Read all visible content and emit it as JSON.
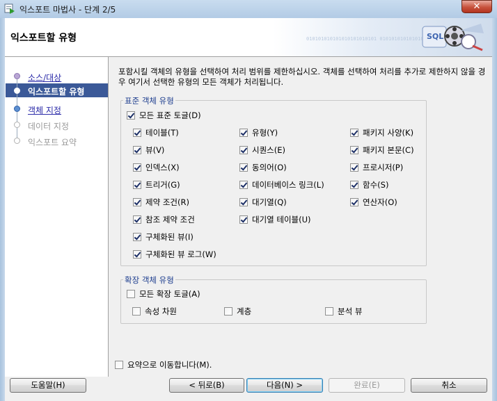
{
  "window": {
    "title": "익스포트 마법사 - 단계 2/5",
    "close_label": "✕"
  },
  "header": {
    "title": "익스포트할 유형",
    "binary_text": "010101010101010101010101 0101010101010101"
  },
  "nav": {
    "steps": [
      {
        "label": "소스/대상",
        "state": "done"
      },
      {
        "label": "익스포트할 유형",
        "state": "current"
      },
      {
        "label": "객체 지정",
        "state": "next"
      },
      {
        "label": "데이터 지정",
        "state": "disabled"
      },
      {
        "label": "익스포트 요약",
        "state": "disabled"
      }
    ]
  },
  "description": "포함시킬 객체의 유형을 선택하여 처리 범위를 제한하십시오. 객체를 선택하여 처리를 추가로 제한하지 않을 경우 여기서 선택한 유형의 모든 객체가 처리됩니다.",
  "standard_group": {
    "legend": "표준 객체 유형",
    "toggle_all": {
      "label": "모든 표준 토글(D)",
      "checked": true
    },
    "items": [
      {
        "label": "테이블(T)",
        "checked": true
      },
      {
        "label": "유형(Y)",
        "checked": true
      },
      {
        "label": "패키지 사양(K)",
        "checked": true
      },
      {
        "label": "뷰(V)",
        "checked": true
      },
      {
        "label": "시퀀스(E)",
        "checked": true
      },
      {
        "label": "패키지 본문(C)",
        "checked": true
      },
      {
        "label": "인덱스(X)",
        "checked": true
      },
      {
        "label": "동의어(O)",
        "checked": true
      },
      {
        "label": "프로시저(P)",
        "checked": true
      },
      {
        "label": "트리거(G)",
        "checked": true
      },
      {
        "label": "데이터베이스 링크(L)",
        "checked": true
      },
      {
        "label": "함수(S)",
        "checked": true
      },
      {
        "label": "제약 조건(R)",
        "checked": true
      },
      {
        "label": "대기열(Q)",
        "checked": true
      },
      {
        "label": "연산자(O)",
        "checked": true
      },
      {
        "label": "참조 제약 조건",
        "checked": true
      },
      {
        "label": "대기열 테이블(U)",
        "checked": true
      },
      {
        "label": "구체화된 뷰(I)",
        "checked": true
      },
      {
        "label": "구체화된 뷰 로그(W)",
        "checked": true
      }
    ]
  },
  "extended_group": {
    "legend": "확장 객체 유형",
    "toggle_all": {
      "label": "모든 확장 토글(A)",
      "checked": false
    },
    "items": [
      {
        "label": "속성 차원",
        "checked": false
      },
      {
        "label": "계층",
        "checked": false
      },
      {
        "label": "분석 뷰",
        "checked": false
      }
    ]
  },
  "skip_summary": {
    "label": "요약으로 이동합니다(M).",
    "checked": false
  },
  "buttons": {
    "help": "도움말(H)",
    "back": "< 뒤로(B)",
    "next": "다음(N) >",
    "finish": "완료(E)",
    "cancel": "취소"
  }
}
